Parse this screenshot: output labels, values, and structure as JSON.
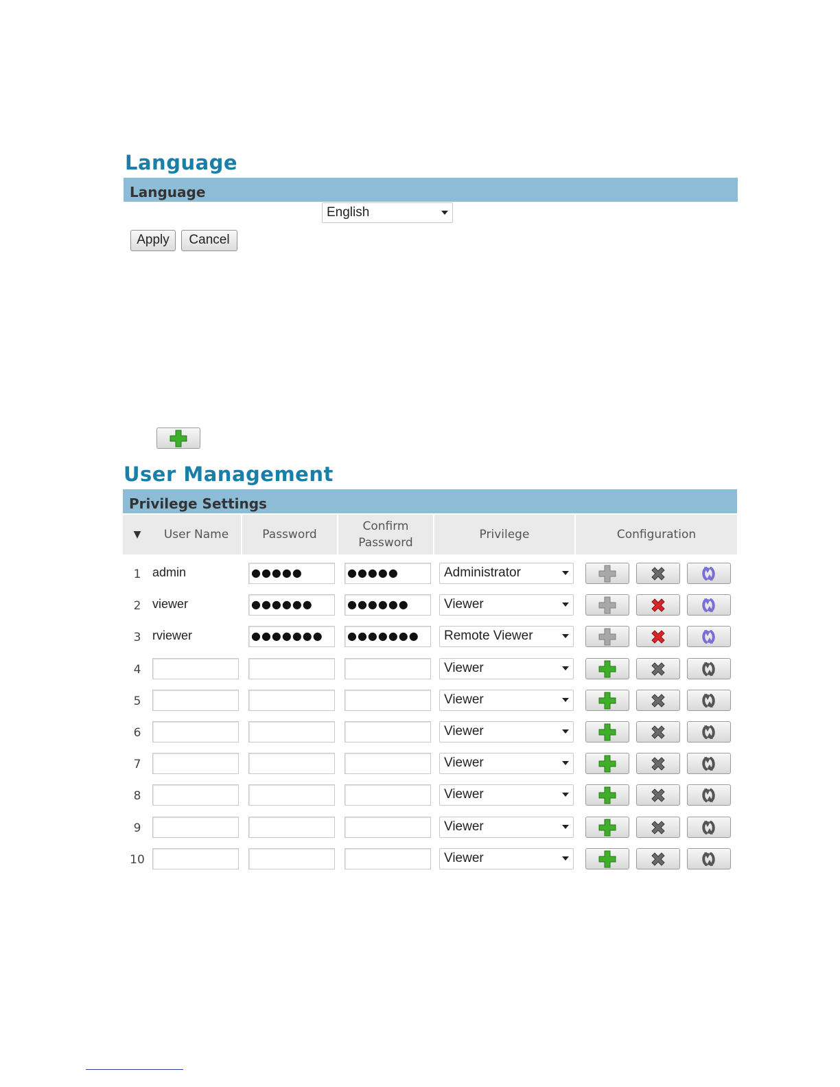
{
  "language_section": {
    "title": "Language",
    "bar_label": "Language",
    "selected_language": "English",
    "apply_label": "Apply",
    "cancel_label": "Cancel"
  },
  "user_management": {
    "title": "User Management",
    "bar_label": "Privilege Settings",
    "columns": {
      "sort": "▼",
      "user_name": "User Name",
      "password": "Password",
      "confirm_password": "Confirm Password",
      "privilege": "Privilege",
      "configuration": "Configuration"
    },
    "rows": [
      {
        "num": "1",
        "user": "admin",
        "password": "●●●●●",
        "confirm": "●●●●●",
        "privilege": "Administrator",
        "add_enabled": false,
        "delete_red": false,
        "refresh_purple": true
      },
      {
        "num": "2",
        "user": "viewer",
        "password": "●●●●●●",
        "confirm": "●●●●●●",
        "privilege": "Viewer",
        "add_enabled": false,
        "delete_red": true,
        "refresh_purple": true
      },
      {
        "num": "3",
        "user": "rviewer",
        "password": "●●●●●●●",
        "confirm": "●●●●●●●",
        "privilege": "Remote Viewer",
        "add_enabled": false,
        "delete_red": true,
        "refresh_purple": true
      },
      {
        "num": "4",
        "user": "",
        "password": "",
        "confirm": "",
        "privilege": "Viewer",
        "add_enabled": true,
        "delete_red": false,
        "refresh_purple": false
      },
      {
        "num": "5",
        "user": "",
        "password": "",
        "confirm": "",
        "privilege": "Viewer",
        "add_enabled": true,
        "delete_red": false,
        "refresh_purple": false
      },
      {
        "num": "6",
        "user": "",
        "password": "",
        "confirm": "",
        "privilege": "Viewer",
        "add_enabled": true,
        "delete_red": false,
        "refresh_purple": false
      },
      {
        "num": "7",
        "user": "",
        "password": "",
        "confirm": "",
        "privilege": "Viewer",
        "add_enabled": true,
        "delete_red": false,
        "refresh_purple": false
      },
      {
        "num": "8",
        "user": "",
        "password": "",
        "confirm": "",
        "privilege": "Viewer",
        "add_enabled": true,
        "delete_red": false,
        "refresh_purple": false
      },
      {
        "num": "9",
        "user": "",
        "password": "",
        "confirm": "",
        "privilege": "Viewer",
        "add_enabled": true,
        "delete_red": false,
        "refresh_purple": false
      },
      {
        "num": "10",
        "user": "",
        "password": "",
        "confirm": "",
        "privilege": "Viewer",
        "add_enabled": true,
        "delete_red": false,
        "refresh_purple": false
      }
    ]
  },
  "colors": {
    "title_blue": "#1a7fa8",
    "section_bar": "#8dbcd6",
    "add_green": "#3fae2a",
    "delete_red": "#d9262a",
    "refresh_purple": "#7a6fd6",
    "disabled_gray": "#9a9a9a"
  },
  "icons": {
    "add": "plus-icon",
    "delete": "x-icon",
    "refresh": "refresh-icon",
    "sort": "triangle-down-icon"
  }
}
